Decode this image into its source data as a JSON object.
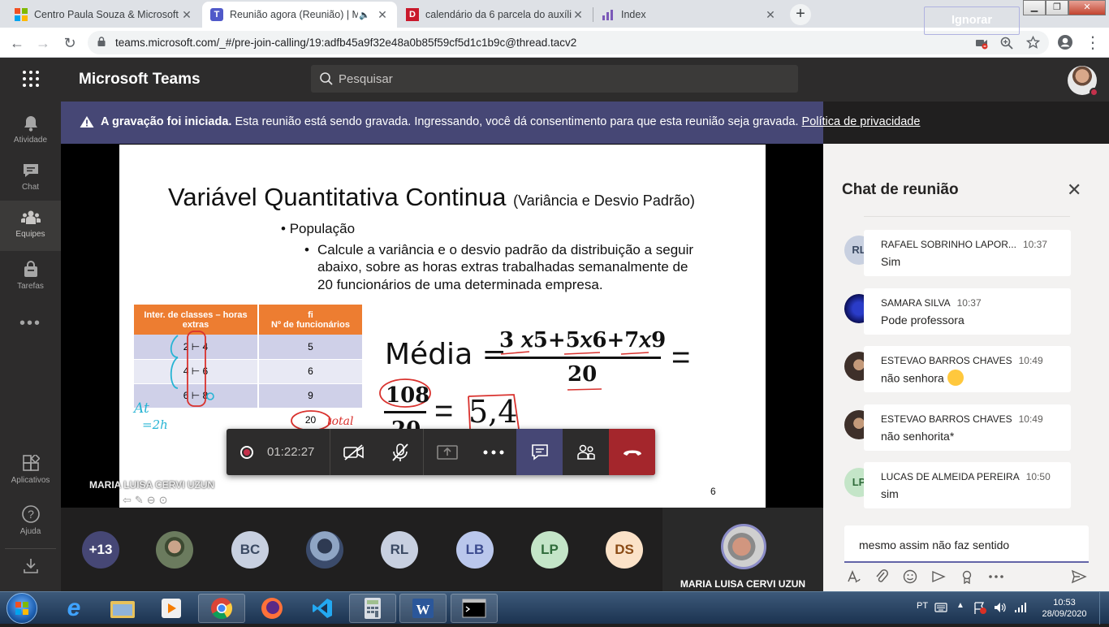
{
  "browser": {
    "tabs": [
      {
        "title": "Centro Paula Souza & Microsoft"
      },
      {
        "title": "Reunião agora (Reunião) | M"
      },
      {
        "title": "calendário da 6 parcela do auxílio"
      },
      {
        "title": "Index"
      }
    ],
    "url": "teams.microsoft.com/_#/pre-join-calling/19:adfb45a9f32e48a0b85f59cf5d1c1b9c@thread.tacv2"
  },
  "teams": {
    "title": "Microsoft Teams",
    "search_placeholder": "Pesquisar"
  },
  "rail": [
    {
      "label": "Atividade"
    },
    {
      "label": "Chat"
    },
    {
      "label": "Equipes"
    },
    {
      "label": "Tarefas"
    },
    {
      "label": "Aplicativos"
    },
    {
      "label": "Ajuda"
    }
  ],
  "banner": {
    "bold": "A gravação foi iniciada.",
    "text": " Esta reunião está sendo gravada. Ingressando, você dá consentimento para que esta reunião seja gravada. ",
    "link": "Política de privacidade",
    "ignore": "Ignorar"
  },
  "slide": {
    "title": "Variável Quantitativa Continua",
    "subtitle": "(Variância e Desvio Padrão)",
    "bullet1": "População",
    "bullet2a": "Calcule a variância e o desvio padrão da distribuição a seguir",
    "bullet2b": "abaixo, sobre as horas extras trabalhadas semanalmente de",
    "bullet2c": "20 funcionários  de uma determinada empresa.",
    "table_headers": [
      "Inter. de classes – horas extras",
      "fi\nNº de funcionários"
    ],
    "table_rows": [
      [
        "2 ⊢ 4",
        "5"
      ],
      [
        "4 ⊢ 6",
        "6"
      ],
      [
        "6 ⊢ 8",
        "9"
      ],
      [
        "",
        "20"
      ]
    ],
    "media_label": "Média =",
    "numerator": "3 𝑥5+5𝑥6+7𝑥9",
    "denominator": "20",
    "num2": "108",
    "den2": "20",
    "result": "5,4",
    "page": "6",
    "annot_at": "At",
    "annot_2h": "=2h",
    "annot_total": "total"
  },
  "presenter": "MARIA LUISA CERVI UZUN",
  "call": {
    "timer": "01:22:27"
  },
  "participants": [
    {
      "initials": "+13",
      "bg": "#464775",
      "fg": "#ffffff"
    },
    {
      "initials": "",
      "bg": "#5b6b4e",
      "fg": "#ffffff"
    },
    {
      "initials": "BC",
      "bg": "#c8d0e0",
      "fg": "#3b4a63"
    },
    {
      "initials": "",
      "bg": "#6a7a98",
      "fg": "#ffffff"
    },
    {
      "initials": "RL",
      "bg": "#c8d0e0",
      "fg": "#3b4a63"
    },
    {
      "initials": "LB",
      "bg": "#bac7ec",
      "fg": "#3b4a8e"
    },
    {
      "initials": "LP",
      "bg": "#c4e5c8",
      "fg": "#2f6b3a"
    },
    {
      "initials": "DS",
      "bg": "#fbe2c8",
      "fg": "#8a4a14"
    }
  ],
  "active_speaker": "MARIA LUISA CERVI UZUN",
  "chat": {
    "title": "Chat de reunião",
    "messages": [
      {
        "initials": "RL",
        "author": "RAFAEL SOBRINHO LAPOR...",
        "time": "10:37",
        "text": "Sim",
        "avatar_bg": "#c8d0e0",
        "avatar_fg": "#3b4a63",
        "status": "busy"
      },
      {
        "initials": "",
        "author": "SAMARA SILVA",
        "time": "10:37",
        "text": "Pode professora",
        "avatar_bg": "#1b1f8a",
        "avatar_fg": "#ffffff",
        "status": "away"
      },
      {
        "initials": "",
        "author": "ESTEVAO BARROS CHAVES",
        "time": "10:49",
        "text": "não senhora",
        "avatar_bg": "#5a4a3e",
        "avatar_fg": "#ffffff",
        "status": "busy"
      },
      {
        "initials": "",
        "author": "ESTEVAO BARROS CHAVES",
        "time": "10:49",
        "text": "não senhorita*",
        "avatar_bg": "#5a4a3e",
        "avatar_fg": "#ffffff",
        "status": "busy"
      },
      {
        "initials": "LP",
        "author": "LUCAS DE ALMEIDA PEREIRA",
        "time": "10:50",
        "text": "sim",
        "avatar_bg": "#c4e5c8",
        "avatar_fg": "#2f6b3a",
        "status": "busy"
      }
    ],
    "compose_value": "mesmo assim não faz sentido"
  },
  "taskbar": {
    "lang": "PT",
    "time": "10:53",
    "date": "28/09/2020"
  },
  "colors": {
    "teams_purple": "#464775",
    "teams_accent": "#6264a7",
    "hangup_red": "#a4262c",
    "busy_red": "#c4314b",
    "table_header": "#ed7d31"
  }
}
